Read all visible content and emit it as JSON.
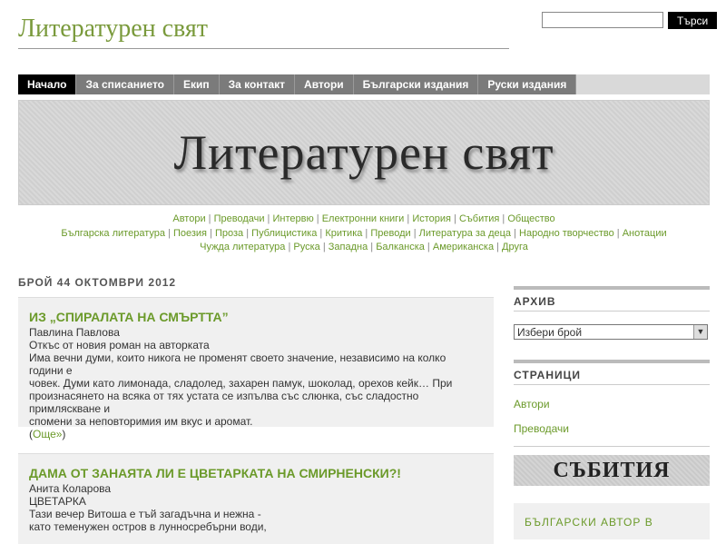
{
  "header": {
    "site_title": "Литературен свят",
    "search_button": "Търси",
    "search_value": ""
  },
  "nav": [
    "Начало",
    "За списанието",
    "Екип",
    "За контакт",
    "Автори",
    "Български издания",
    "Руски издания"
  ],
  "banner": {
    "title": "Литературен свят"
  },
  "categories": {
    "row1": [
      "Автори",
      "Преводачи",
      "Интервю",
      "Електронни книги",
      "История",
      "Събития",
      "Общество"
    ],
    "row2": [
      "Българска литература",
      "Поезия",
      "Проза",
      "Публицистика",
      "Критика",
      "Преводи",
      "Литература за деца",
      "Народно творчество",
      "Анотации"
    ],
    "row3": [
      "Чужда литература",
      "Руска",
      "Западна",
      "Балканска",
      "Американска",
      "Друга"
    ]
  },
  "issue": "БРОЙ 44 ОКТОМВРИ 2012",
  "posts": [
    {
      "title": "ИЗ „СПИРАЛАТА НА СМЪРТТА”",
      "author": "Павлина Павлова",
      "lines": [
        "Откъс от новия роман на авторката",
        "Има вечни думи, които никога не променят своето значение, независимо на колко години е",
        "човек. Думи като лимонада, сладолед, захарен памук, шоколад, орехов кейк… При",
        "произнасянето на всяка от тях устата се изпълва със слюнка, със сладостно примляскване и",
        "спомени за неповторимия им вкус и аромат."
      ],
      "more": "Още»"
    },
    {
      "title": "ДАМА ОТ ЗАНАЯТА ЛИ Е ЦВЕТАРКАТА НА СМИРНЕНСКИ?!",
      "author": "Анита Коларова",
      "lines": [
        "ЦВЕТАРКА",
        "Тази вечер Витоша е тъй загадъчна и нежна -",
        "като теменужен остров в лунносребърни води,"
      ]
    }
  ],
  "sidebar": {
    "archive_title": "АРХИВ",
    "archive_select": "Избери брой",
    "pages_title": "СТРАНИЦИ",
    "pages": [
      "Автори",
      "Преводачи"
    ],
    "events_label": "СЪБИТИЯ",
    "box_text": "БЪЛГАРСКИ АВТОР В"
  }
}
